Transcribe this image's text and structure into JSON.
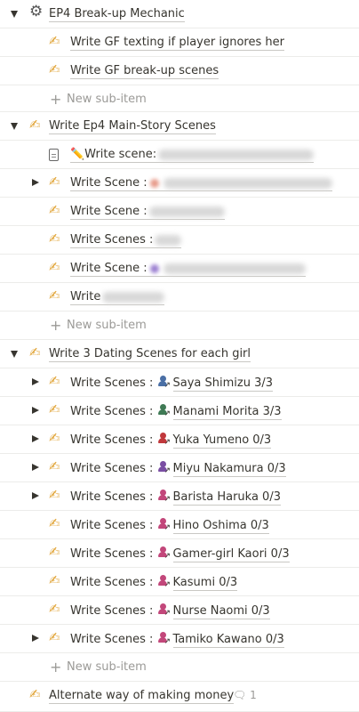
{
  "colors": {
    "text": "#37352f",
    "muted": "#9b9a97",
    "divider": "#ececea",
    "hand": "#e1a53a"
  },
  "rows": [
    {
      "level": 0,
      "toggle": "down",
      "icon": "gear-icon",
      "title": "EP4 Break-up Mechanic"
    },
    {
      "level": 1,
      "icon": "writing-hand-icon",
      "title": "Write GF texting if player ignores her"
    },
    {
      "level": 1,
      "icon": "writing-hand-icon",
      "title": "Write GF break-up scenes"
    },
    {
      "level": 1,
      "type": "new",
      "title": "New sub-item"
    },
    {
      "level": 0,
      "toggle": "down",
      "icon": "writing-hand-icon",
      "title": "Write Ep4 Main-Story Scenes"
    },
    {
      "level": 1,
      "icon": "document-icon",
      "title": "✏️Write scene:",
      "blur": "Kasumi fails exam tonight"
    },
    {
      "level": 1,
      "toggle": "right",
      "icon": "writing-hand-icon",
      "title": "Write Scene :",
      "blur": "Date with Kasumi at Saturday night"
    },
    {
      "level": 1,
      "icon": "writing-hand-icon",
      "title": "Write Scene :",
      "blur": "Lake and girls"
    },
    {
      "level": 1,
      "icon": "writing-hand-icon",
      "title": "Write Scenes :",
      "blur": "Ch2"
    },
    {
      "level": 1,
      "icon": "writing-hand-icon",
      "title": "Write Scene :",
      "blur": "Date with Miyu Nakamura"
    },
    {
      "level": 1,
      "icon": "writing-hand-icon",
      "title": "Write",
      "blur": "scene Friday"
    },
    {
      "level": 1,
      "type": "new",
      "title": "New sub-item"
    },
    {
      "level": 0,
      "toggle": "down",
      "icon": "writing-hand-icon",
      "title": "Write 3 Dating Scenes for each girl"
    },
    {
      "level": 1,
      "toggle": "right",
      "icon": "writing-hand-icon",
      "title": "Write Scenes :",
      "person": "blue",
      "link": "Saya Shimizu 3/3"
    },
    {
      "level": 1,
      "toggle": "right",
      "icon": "writing-hand-icon",
      "title": "Write Scenes :",
      "person": "green",
      "link": "Manami Morita 3/3"
    },
    {
      "level": 1,
      "toggle": "right",
      "icon": "writing-hand-icon",
      "title": "Write Scenes :",
      "person": "red",
      "link": "Yuka Yumeno 0/3"
    },
    {
      "level": 1,
      "toggle": "right",
      "icon": "writing-hand-icon",
      "title": "Write Scenes :",
      "person": "purple",
      "link": "Miyu Nakamura 0/3"
    },
    {
      "level": 1,
      "toggle": "right",
      "icon": "writing-hand-icon",
      "title": "Write Scenes :",
      "person": "pink",
      "link": "Barista Haruka 0/3"
    },
    {
      "level": 1,
      "icon": "writing-hand-icon",
      "title": "Write Scenes :",
      "person": "pink",
      "link": "Hino Oshima 0/3"
    },
    {
      "level": 1,
      "icon": "writing-hand-icon",
      "title": "Write Scenes :",
      "person": "pink",
      "link": "Gamer-girl Kaori 0/3"
    },
    {
      "level": 1,
      "icon": "writing-hand-icon",
      "title": "Write Scenes :",
      "person": "pink",
      "link": "Kasumi 0/3"
    },
    {
      "level": 1,
      "icon": "writing-hand-icon",
      "title": "Write Scenes :",
      "person": "pink",
      "link": "Nurse Naomi 0/3"
    },
    {
      "level": 1,
      "toggle": "right",
      "icon": "writing-hand-icon",
      "title": "Write Scenes :",
      "person": "pink",
      "link": "Tamiko Kawano 0/3"
    },
    {
      "level": 1,
      "type": "new",
      "title": "New sub-item"
    },
    {
      "level": 0,
      "icon": "writing-hand-icon",
      "title": "Alternate way of making money",
      "comments": "1"
    }
  ]
}
